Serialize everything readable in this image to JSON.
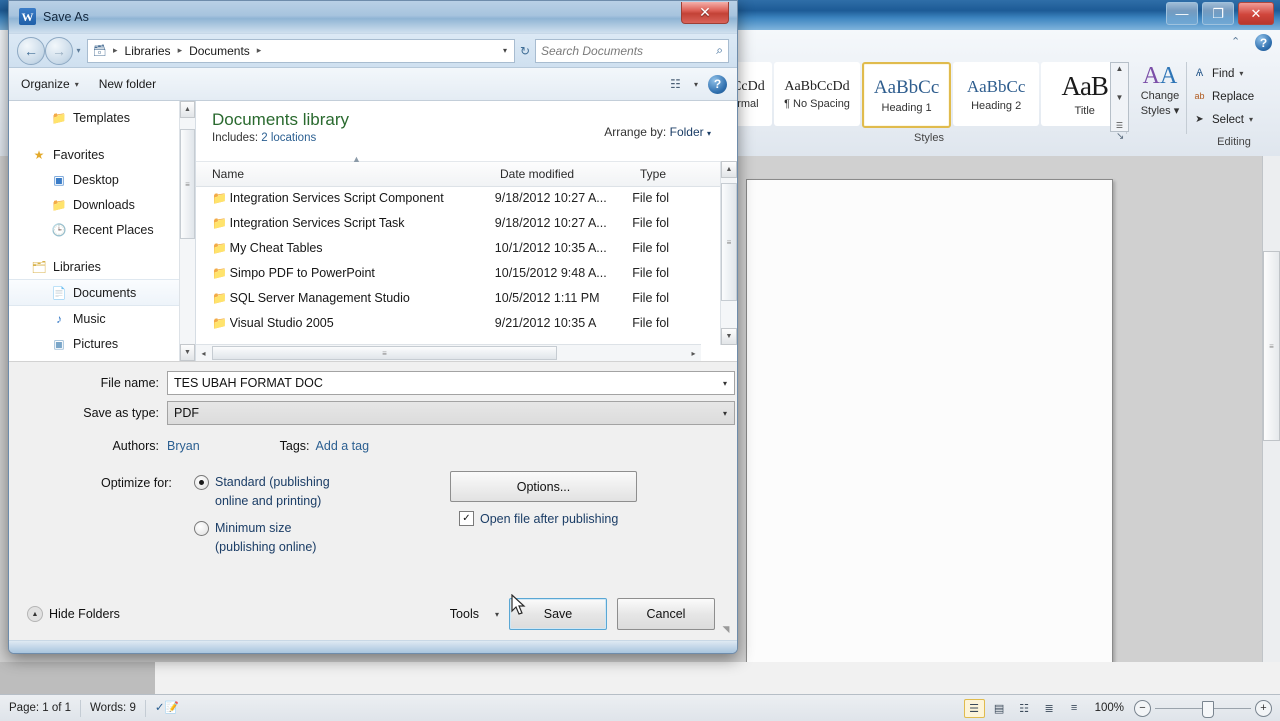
{
  "word": {
    "window_controls": [
      {
        "name": "minimize",
        "glyph": "—"
      },
      {
        "name": "restore",
        "glyph": "❐"
      },
      {
        "name": "close",
        "glyph": "✕"
      }
    ],
    "ribbon_help": {
      "collapse_glyph": "⌃",
      "help_glyph": "?"
    },
    "styles": {
      "group_label": "Styles",
      "dialog_launcher": "↘",
      "scroll_up": "▲",
      "scroll_down": "▼",
      "scroll_more": "☰",
      "items": [
        {
          "preview": "bCcDd",
          "name": "ormal",
          "selected": false
        },
        {
          "preview": "AaBbCcDd",
          "name": "¶ No Spacing",
          "selected": false
        },
        {
          "preview": "AaBbCс",
          "name": "Heading 1",
          "selected": true
        },
        {
          "preview": "AaBbCc",
          "name": "Heading 2",
          "selected": false
        },
        {
          "preview": "AaB",
          "name": "Title",
          "selected": false
        }
      ]
    },
    "change_styles": {
      "label_line1": "Change",
      "label_line2": "Styles",
      "caret": "▾",
      "icon_a": "A",
      "icon_b": "A"
    },
    "editing": {
      "group_label": "Editing",
      "items": [
        {
          "label": "Find",
          "icon": "binoculars-icon",
          "glyph": "Ѧ",
          "caret": "▾"
        },
        {
          "label": "Replace",
          "icon": "replace-icon",
          "glyph": "ab",
          "caret": ""
        },
        {
          "label": "Select",
          "icon": "select-pointer-icon",
          "glyph": "➤",
          "caret": "▾"
        }
      ]
    },
    "document_scrollbar": {
      "up": "▲",
      "down": "▼",
      "thumb_grip": "≡"
    },
    "right_mini_buttons": [
      {
        "name": "ruler-toggle",
        "glyph": "▭"
      },
      {
        "name": "split-window",
        "glyph": "⧉"
      },
      {
        "name": "previous-page",
        "glyph": "▲"
      }
    ],
    "statusbar": {
      "page": "Page: 1 of 1",
      "words": "Words: 9",
      "proofing_icon": "spellcheck-icon",
      "view_buttons": [
        {
          "name": "print-layout",
          "glyph": "☰",
          "active": true
        },
        {
          "name": "full-screen-reading",
          "glyph": "▤",
          "active": false
        },
        {
          "name": "web-layout",
          "glyph": "☷",
          "active": false
        },
        {
          "name": "outline",
          "glyph": "≣",
          "active": false
        },
        {
          "name": "draft",
          "glyph": "≡",
          "active": false
        }
      ],
      "zoom_level": "100%",
      "zoom_out": "−",
      "zoom_in": "+"
    }
  },
  "dialog": {
    "title": "Save As",
    "app_badge": "W",
    "close_glyph": "✕",
    "nav": {
      "back": "←",
      "forward": "→",
      "history_caret": "▾",
      "address_icon": "library-icon",
      "breadcrumbs": [
        "Libraries",
        "Documents"
      ],
      "crumb_sep": "▸",
      "address_dropdown": "▾",
      "refresh": "↻"
    },
    "search": {
      "placeholder": "Search Documents",
      "icon": "search-icon",
      "icon_glyph": "⌕"
    },
    "toolbar": {
      "organize": "Organize",
      "organize_caret": "▾",
      "new_folder": "New folder",
      "view_icon": "view-list-icon",
      "view_caret": "▾",
      "help_icon": "help-icon",
      "help_glyph": "?"
    },
    "nav_pane": {
      "items": [
        {
          "label": "Templates",
          "icon": "folder-icon",
          "glyph": "📁",
          "level": "indent",
          "selected": false
        },
        {
          "label": "",
          "icon": "spacer",
          "glyph": "",
          "level": "gap",
          "selected": false
        },
        {
          "label": "Favorites",
          "icon": "star-icon",
          "glyph": "★",
          "level": "group",
          "selected": false
        },
        {
          "label": "Desktop",
          "icon": "desktop-icon",
          "glyph": "▣",
          "level": "indent",
          "selected": false
        },
        {
          "label": "Downloads",
          "icon": "downloads-icon",
          "glyph": "📁",
          "level": "indent",
          "selected": false
        },
        {
          "label": "Recent Places",
          "icon": "recent-places-icon",
          "glyph": "⌚",
          "level": "indent",
          "selected": false
        },
        {
          "label": "",
          "icon": "spacer",
          "glyph": "",
          "level": "gap",
          "selected": false
        },
        {
          "label": "Libraries",
          "icon": "libraries-icon",
          "glyph": "🗂",
          "level": "group",
          "selected": false
        },
        {
          "label": "Documents",
          "icon": "documents-library-icon",
          "glyph": "📄",
          "level": "indent",
          "selected": true
        },
        {
          "label": "Music",
          "icon": "music-library-icon",
          "glyph": "♪",
          "level": "indent",
          "selected": false
        },
        {
          "label": "Pictures",
          "icon": "pictures-library-icon",
          "glyph": "▣",
          "level": "indent",
          "selected": false
        }
      ],
      "scroll_thumb_grip": "≡"
    },
    "library": {
      "title": "Documents library",
      "includes_label": "Includes:",
      "includes_value": "2 locations",
      "arrange_label": "Arrange by:",
      "arrange_value": "Folder",
      "arrange_caret": "▾"
    },
    "columns": {
      "name": "Name",
      "date_modified": "Date modified",
      "type": "Type",
      "sort_mark": "▲"
    },
    "files": [
      {
        "name": "Integration Services Script Component",
        "date": "9/18/2012 10:27 A...",
        "type": "File fol",
        "icon": "folder-icon",
        "glyph": "📁"
      },
      {
        "name": "Integration Services Script Task",
        "date": "9/18/2012 10:27 A...",
        "type": "File fol",
        "icon": "folder-icon",
        "glyph": "📁"
      },
      {
        "name": "My Cheat Tables",
        "date": "10/1/2012 10:35 A...",
        "type": "File fol",
        "icon": "folder-icon",
        "glyph": "📁"
      },
      {
        "name": "Simpo PDF to PowerPoint",
        "date": "10/15/2012 9:48 A...",
        "type": "File fol",
        "icon": "folder-icon",
        "glyph": "📁"
      },
      {
        "name": "SQL Server Management Studio",
        "date": "10/5/2012 1:11 PM",
        "type": "File fol",
        "icon": "folder-icon",
        "glyph": "📁"
      },
      {
        "name": "Visual Studio 2005",
        "date": "9/21/2012 10:35 A",
        "type": "File fol",
        "icon": "folder-icon",
        "glyph": "📁"
      }
    ],
    "list_scroll": {
      "up": "▲",
      "down": "▼",
      "left": "◂",
      "right": "▸",
      "grip": "≡"
    },
    "form": {
      "file_name_label": "File name:",
      "file_name_value": "TES UBAH FORMAT DOC",
      "save_as_type_label": "Save as type:",
      "save_as_type_value": "PDF",
      "combo_arrow": "▾",
      "authors_label": "Authors:",
      "authors_value": "Bryan",
      "tags_label": "Tags:",
      "tags_value": "Add a tag",
      "optimize_label": "Optimize for:",
      "options": [
        {
          "line1": "Standard (publishing",
          "line2": "online and printing)",
          "selected": true
        },
        {
          "line1": "Minimum size",
          "line2": "(publishing online)",
          "selected": false
        }
      ],
      "options_button": "Options...",
      "open_after_label": "Open file after publishing",
      "open_after_checked": true,
      "checkmark": "✓"
    },
    "footer": {
      "hide_folders": "Hide Folders",
      "hide_folders_glyph": "▲",
      "tools": "Tools",
      "tools_caret": "▾",
      "save": "Save",
      "cancel": "Cancel",
      "resize_grip": "◥"
    }
  },
  "colors": {
    "accent_blue": "#2b5f91",
    "library_green": "#2a6a2f",
    "selected_style_border": "#e0bb4d",
    "save_button_border": "#5aa7d4",
    "close_red": "#c34236"
  }
}
